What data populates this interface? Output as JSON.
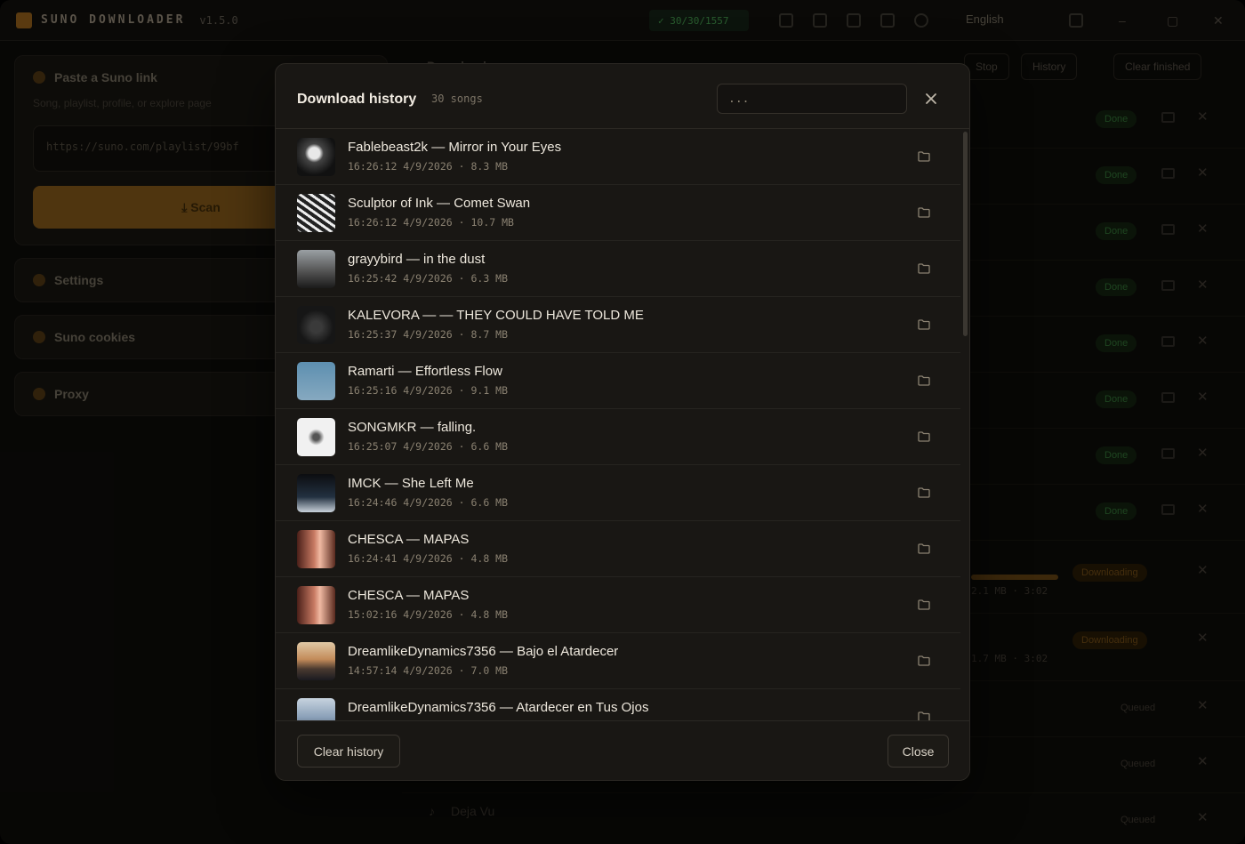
{
  "app": {
    "title": "SUNO DOWNLOADER",
    "version": "v1.5.0",
    "status_badge": "✓ 30/30/1557",
    "language": "English"
  },
  "left": {
    "paste_title": "Paste a Suno link",
    "paste_sub": "Song, playlist, profile, or explore page",
    "url_value": "https://suno.com/playlist/99bf",
    "scan_label": "⤓  Scan",
    "settings_label": "Settings",
    "cookies_label": "Suno cookies",
    "proxy_label": "Proxy"
  },
  "right": {
    "queue_title": "Download queue",
    "stop_label": "Stop",
    "history_label": "History",
    "clear_finished_label": "Clear finished",
    "status_done": "Done",
    "status_downloading": "Downloading",
    "status_queued": "Queued",
    "dl_sub_1": "2.1 MB · 3:02",
    "dl_sub_2": "1.7 MB · 3:02",
    "last_song": "Deja Vu"
  },
  "modal": {
    "title": "Download history",
    "count": "30 songs",
    "search_placeholder": "...",
    "clear_label": "Clear history",
    "close_label": "Close",
    "items": [
      {
        "title": "Fablebeast2k — Mirror in Your Eyes",
        "meta": "16:26:12 4/9/2026 · 8.3 MB",
        "thumb": "t1"
      },
      {
        "title": "Sculptor of Ink — Comet Swan",
        "meta": "16:26:12 4/9/2026 · 10.7 MB",
        "thumb": "t2"
      },
      {
        "title": "grayybird — in the dust",
        "meta": "16:25:42 4/9/2026 · 6.3 MB",
        "thumb": "t3"
      },
      {
        "title": "KALEVORA — — THEY COULD HAVE TOLD ME",
        "meta": "16:25:37 4/9/2026 · 8.7 MB",
        "thumb": "t4"
      },
      {
        "title": "Ramarti — Effortless Flow",
        "meta": "16:25:16 4/9/2026 · 9.1 MB",
        "thumb": "t5"
      },
      {
        "title": "SONGMKR — falling.",
        "meta": "16:25:07 4/9/2026 · 6.6 MB",
        "thumb": "t6"
      },
      {
        "title": "IMCK — She Left Me",
        "meta": "16:24:46 4/9/2026 · 6.6 MB",
        "thumb": "t7"
      },
      {
        "title": "CHESCA — MAPAS",
        "meta": "16:24:41 4/9/2026 · 4.8 MB",
        "thumb": "t8"
      },
      {
        "title": "CHESCA — MAPAS",
        "meta": "15:02:16 4/9/2026 · 4.8 MB",
        "thumb": "t8"
      },
      {
        "title": "DreamlikeDynamics7356 — Bajo el Atardecer",
        "meta": "14:57:14 4/9/2026 · 7.0 MB",
        "thumb": "t9"
      },
      {
        "title": "DreamlikeDynamics7356 — Atardecer en Tus Ojos",
        "meta": "",
        "thumb": "t10"
      }
    ]
  }
}
